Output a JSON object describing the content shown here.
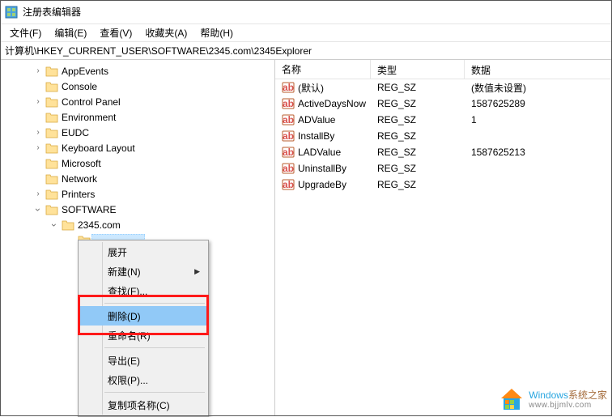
{
  "window": {
    "title": "注册表编辑器"
  },
  "menu": {
    "file": "文件(F)",
    "edit": "编辑(E)",
    "view": "查看(V)",
    "favorites": "收藏夹(A)",
    "help": "帮助(H)"
  },
  "address": "计算机\\HKEY_CURRENT_USER\\SOFTWARE\\2345.com\\2345Explorer",
  "tree": [
    {
      "label": "AppEvents",
      "indent": 1,
      "arrow": "right"
    },
    {
      "label": "Console",
      "indent": 1,
      "arrow": ""
    },
    {
      "label": "Control Panel",
      "indent": 1,
      "arrow": "right"
    },
    {
      "label": "Environment",
      "indent": 1,
      "arrow": ""
    },
    {
      "label": "EUDC",
      "indent": 1,
      "arrow": "right"
    },
    {
      "label": "Keyboard Layout",
      "indent": 1,
      "arrow": "right"
    },
    {
      "label": "Microsoft",
      "indent": 1,
      "arrow": ""
    },
    {
      "label": "Network",
      "indent": 1,
      "arrow": ""
    },
    {
      "label": "Printers",
      "indent": 1,
      "arrow": "right"
    },
    {
      "label": "SOFTWARE",
      "indent": 1,
      "arrow": "down"
    },
    {
      "label": "2345.com",
      "indent": 2,
      "arrow": "down"
    },
    {
      "label": "",
      "indent": 3,
      "arrow": "",
      "selected": true
    }
  ],
  "columns": {
    "name": "名称",
    "type": "类型",
    "data": "数据"
  },
  "values": [
    {
      "name": "(默认)",
      "type": "REG_SZ",
      "data": "(数值未设置)"
    },
    {
      "name": "ActiveDaysNow",
      "type": "REG_SZ",
      "data": "1587625289"
    },
    {
      "name": "ADValue",
      "type": "REG_SZ",
      "data": "1"
    },
    {
      "name": "InstallBy",
      "type": "REG_SZ",
      "data": ""
    },
    {
      "name": "LADValue",
      "type": "REG_SZ",
      "data": "1587625213"
    },
    {
      "name": "UninstallBy",
      "type": "REG_SZ",
      "data": ""
    },
    {
      "name": "UpgradeBy",
      "type": "REG_SZ",
      "data": ""
    }
  ],
  "context_menu": {
    "expand": "展开",
    "new": "新建(N)",
    "find": "查找(F)...",
    "delete": "删除(D)",
    "rename": "重命名(R)",
    "export": "导出(E)",
    "permissions": "权限(P)...",
    "copy_key_name": "复制项名称(C)"
  },
  "watermark": {
    "brand1": "Windows",
    "brand2": "系统之家",
    "url": "www.bjjmlv.com"
  }
}
